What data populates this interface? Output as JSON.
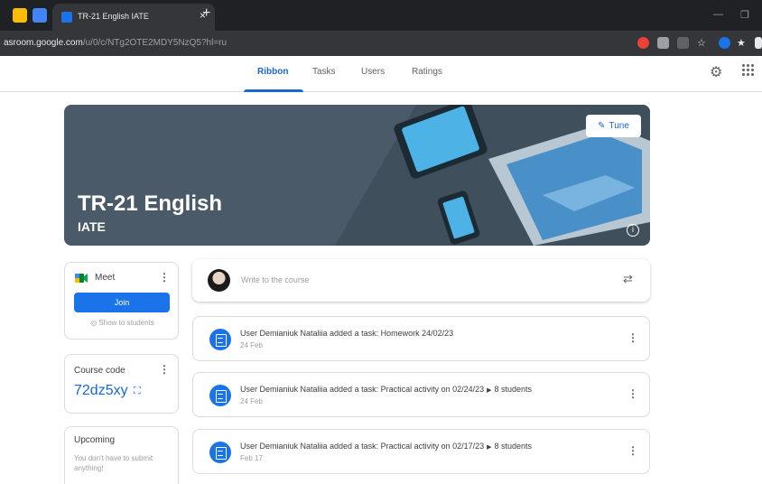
{
  "browser": {
    "tab_title": "TR-21 English IATE",
    "tab_close": "×",
    "new_tab": "+",
    "url_host": "asroom.google.com",
    "url_path": "/u/0/c/NTg2OTE2MDY5NzQ5?hl=ru"
  },
  "nav": {
    "tabs": [
      {
        "label": "Ribbon",
        "active": true
      },
      {
        "label": "Tasks",
        "active": false
      },
      {
        "label": "Users",
        "active": false
      },
      {
        "label": "Ratings",
        "active": false
      }
    ]
  },
  "banner": {
    "title": "TR-21 English",
    "subtitle": "IATE",
    "tune_label": "Tune"
  },
  "meet": {
    "label": "Meet",
    "join_label": "Join",
    "show_label": "Show to students"
  },
  "course_code": {
    "label": "Course code",
    "value": "72dz5xy"
  },
  "upcoming": {
    "label": "Upcoming",
    "text": "You don't have to submit anything!"
  },
  "compose": {
    "placeholder": "Write to the course"
  },
  "posts": [
    {
      "text": "User Demianiuk Nataliia added a task: Homework 24/02/23",
      "extra": "",
      "date": "24 Feb"
    },
    {
      "text": "User Demianiuk Nataliia added a task: Practical activity on 02/24/23",
      "extra": "8 students",
      "date": "24 Feb"
    },
    {
      "text": "User Demianiuk Nataliia added a task: Practical activity on 02/17/23",
      "extra": "8 students",
      "date": "Feb 17"
    }
  ],
  "colors": {
    "accent": "#1967d2",
    "join_button": "#1a73e8",
    "banner": "#4a5a68",
    "chrome_dark": "#202124"
  }
}
